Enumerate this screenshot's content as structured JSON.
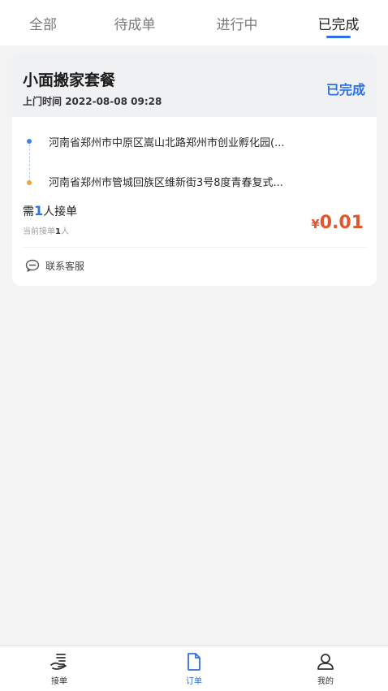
{
  "tabs": [
    {
      "label": "全部",
      "active": false
    },
    {
      "label": "待成单",
      "active": false
    },
    {
      "label": "进行中",
      "active": false
    },
    {
      "label": "已完成",
      "active": true
    }
  ],
  "order": {
    "title": "小面搬家套餐",
    "visit_time_label": "上门时间",
    "visit_time": "2022-08-08 09:28",
    "status": "已完成",
    "from_address": "河南省郑州市中原区嵩山北路郑州市创业孵化园(...",
    "to_address": "河南省郑州市管城回族区维新街3号8度青春复式...",
    "need_prefix": "需",
    "need_count": "1",
    "need_suffix": "人接单",
    "current_prefix": "当前接单",
    "current_count": "1",
    "current_suffix": "人",
    "price_symbol": "¥",
    "price": "0.01",
    "contact_label": "联系客服"
  },
  "bottom_nav": [
    {
      "label": "接单",
      "icon": "hand-list-icon",
      "active": false
    },
    {
      "label": "订单",
      "icon": "document-icon",
      "active": true
    },
    {
      "label": "我的",
      "icon": "user-icon",
      "active": false
    }
  ],
  "colors": {
    "accent": "#2f6fe4",
    "price": "#e0562e",
    "route_start": "#4b7ee8",
    "route_end": "#f2a33a"
  }
}
